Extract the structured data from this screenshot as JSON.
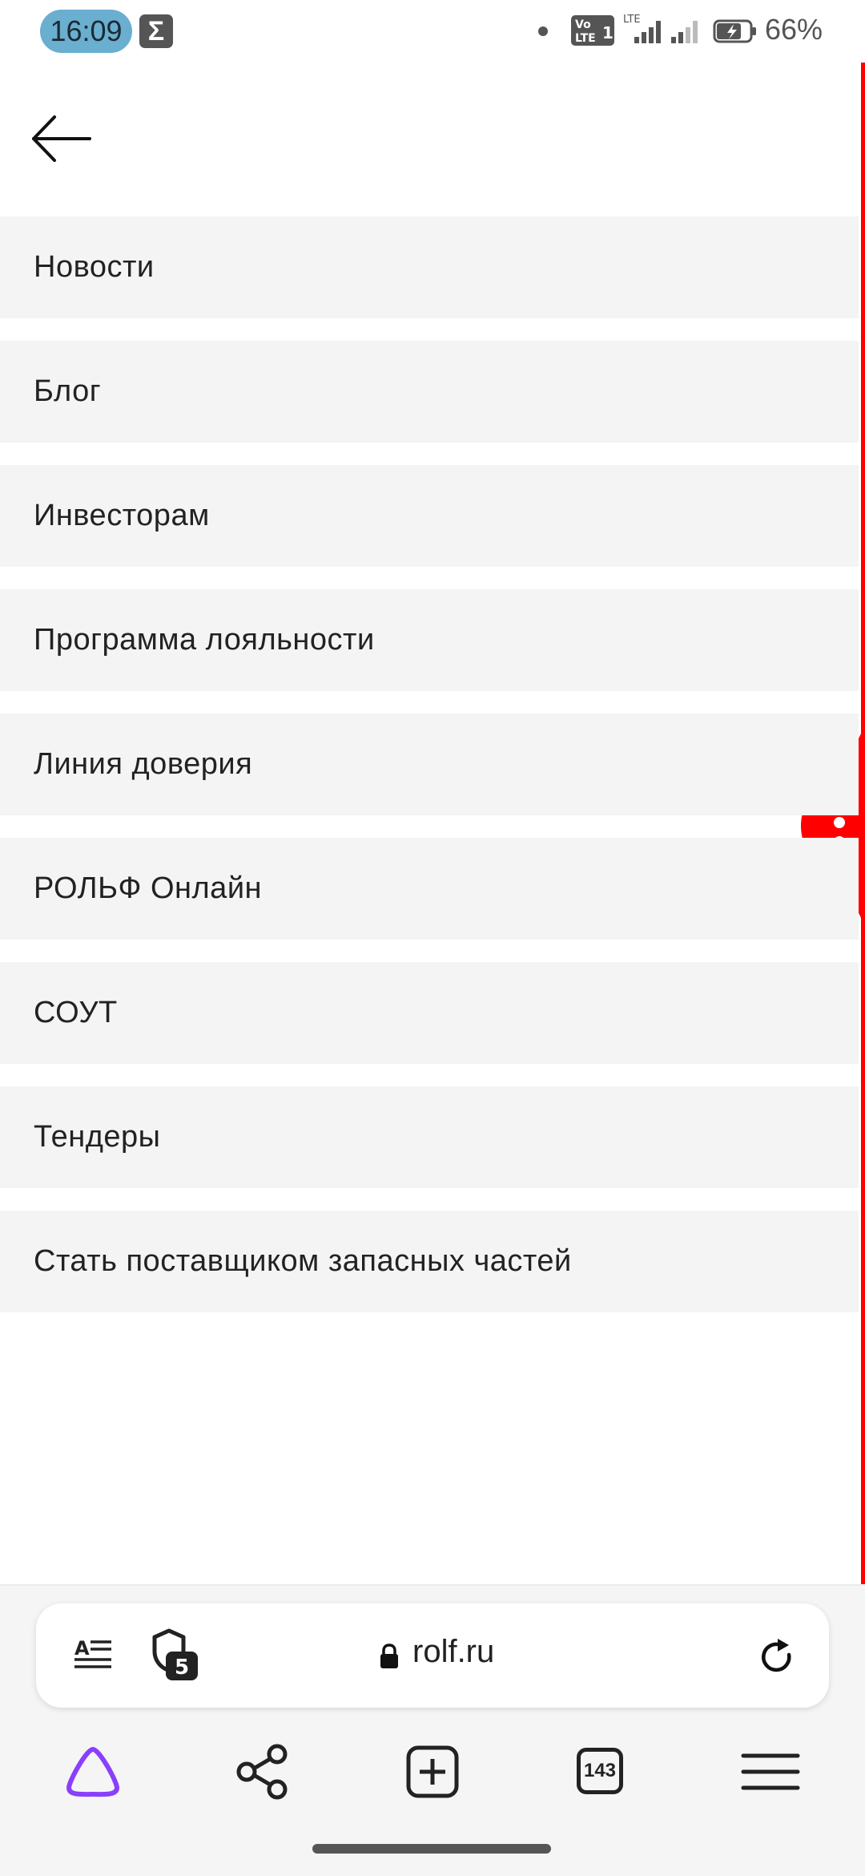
{
  "status_bar": {
    "time": "16:09",
    "battery": "66%",
    "sigma_glyph": "Σ"
  },
  "header": {
    "back_icon": "arrow-left-icon"
  },
  "menu": {
    "items": [
      {
        "label": "Новости"
      },
      {
        "label": "Блог"
      },
      {
        "label": "Инвесторам"
      },
      {
        "label": "Программа лояльности"
      },
      {
        "label": "Линия доверия"
      },
      {
        "label": "РОЛЬФ Онлайн"
      },
      {
        "label": "СОУТ"
      },
      {
        "label": "Тендеры"
      },
      {
        "label": "Стать поставщиком запасных частей"
      }
    ]
  },
  "address_bar": {
    "url": "rolf.ru",
    "trackers_blocked": "5"
  },
  "nav": {
    "tabs_count": "143"
  },
  "colors": {
    "accent_red": "#ff0000",
    "assistant_purple": "#8a3ffc",
    "menu_item_bg": "#f4f4f4"
  }
}
